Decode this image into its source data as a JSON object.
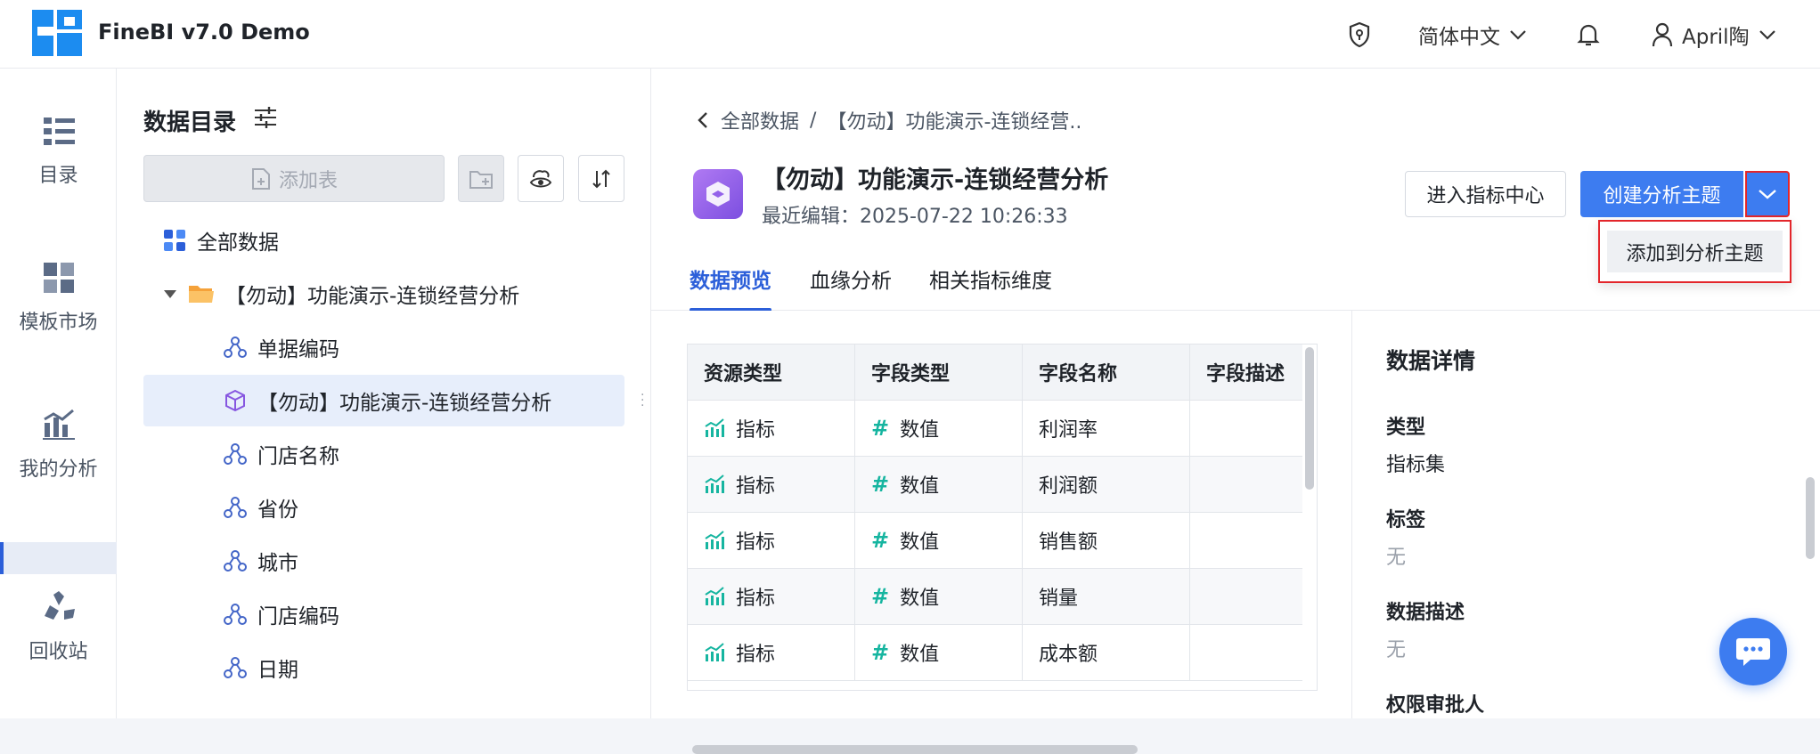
{
  "header": {
    "app_title": "FineBI v7.0 Demo",
    "language": "简体中文",
    "user": "April陶"
  },
  "nav": {
    "items": [
      {
        "label": "目录",
        "icon": "list-icon"
      },
      {
        "label": "模板市场",
        "icon": "template-icon"
      },
      {
        "label": "我的分析",
        "icon": "analysis-chart-icon"
      },
      {
        "label": "回收站",
        "icon": "recycle-icon"
      }
    ]
  },
  "catalog": {
    "title": "数据目录",
    "add_table": "添加表",
    "tree": [
      {
        "label": "全部数据",
        "icon": "grid-apps-icon"
      },
      {
        "label": "【勿动】功能演示-连锁经营分析",
        "icon": "folder-icon"
      },
      {
        "label": "单据编码",
        "icon": "dimension-node-icon"
      },
      {
        "label": "【勿动】功能演示-连锁经营分析",
        "icon": "cube-icon",
        "selected": true
      },
      {
        "label": "门店名称",
        "icon": "dimension-node-icon"
      },
      {
        "label": "省份",
        "icon": "dimension-node-icon"
      },
      {
        "label": "城市",
        "icon": "dimension-node-icon"
      },
      {
        "label": "门店编码",
        "icon": "dimension-node-icon"
      },
      {
        "label": "日期",
        "icon": "dimension-node-icon"
      }
    ]
  },
  "main": {
    "breadcrumb": {
      "root": "全部数据",
      "separator": "/",
      "current": "【勿动】功能演示-连锁经营.."
    },
    "dataset_title": "【勿动】功能演示-连锁经营分析",
    "last_edited": "最近编辑：2025-07-22 10:26:33",
    "btn_metric_center": "进入指标中心",
    "btn_create_topic": "创建分析主题",
    "dropdown_item": "添加到分析主题",
    "tabs": [
      "数据预览",
      "血缘分析",
      "相关指标维度"
    ],
    "table": {
      "headers": [
        "资源类型",
        "字段类型",
        "字段名称",
        "字段描述"
      ],
      "rows": [
        {
          "resource": "指标",
          "ftype": "数值",
          "fname": "利润率",
          "desc": ""
        },
        {
          "resource": "指标",
          "ftype": "数值",
          "fname": "利润额",
          "desc": ""
        },
        {
          "resource": "指标",
          "ftype": "数值",
          "fname": "销售额",
          "desc": ""
        },
        {
          "resource": "指标",
          "ftype": "数值",
          "fname": "销量",
          "desc": ""
        },
        {
          "resource": "指标",
          "ftype": "数值",
          "fname": "成本额",
          "desc": ""
        }
      ]
    },
    "details": {
      "title": "数据详情",
      "type_label": "类型",
      "type_value": "指标集",
      "tag_label": "标签",
      "tag_value": "无",
      "desc_label": "数据描述",
      "desc_value": "无",
      "approver_label": "权限审批人"
    }
  },
  "colors": {
    "primary": "#3d7cf0",
    "highlight_border": "#e3262b",
    "metric_icon": "#16b5a0",
    "numeric_icon": "#16b5a0"
  }
}
